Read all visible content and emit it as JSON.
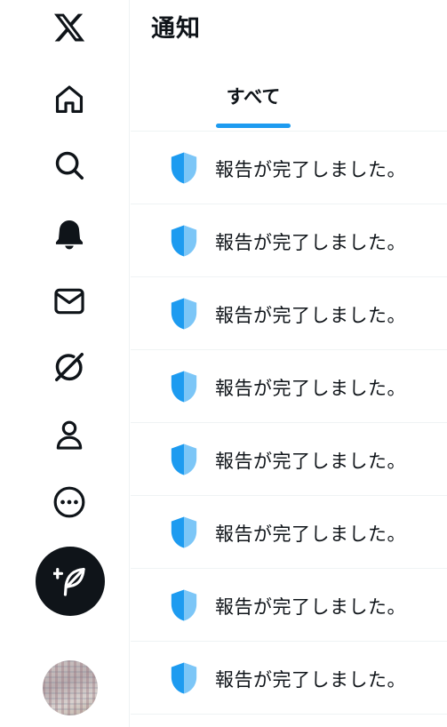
{
  "header": {
    "title": "通知"
  },
  "tabs": [
    {
      "label": "すべて",
      "active": true
    }
  ],
  "nav": {
    "items": [
      {
        "icon": "x-logo-icon"
      },
      {
        "icon": "home-icon"
      },
      {
        "icon": "search-icon"
      },
      {
        "icon": "notifications-bell-icon"
      },
      {
        "icon": "messages-mail-icon"
      },
      {
        "icon": "grok-icon"
      },
      {
        "icon": "profile-person-icon"
      },
      {
        "icon": "more-icon"
      }
    ],
    "compose": {
      "icon": "compose-post-icon"
    }
  },
  "notifications": [
    {
      "icon": "shield-icon",
      "text": "報告が完了しました。"
    },
    {
      "icon": "shield-icon",
      "text": "報告が完了しました。"
    },
    {
      "icon": "shield-icon",
      "text": "報告が完了しました。"
    },
    {
      "icon": "shield-icon",
      "text": "報告が完了しました。"
    },
    {
      "icon": "shield-icon",
      "text": "報告が完了しました。"
    },
    {
      "icon": "shield-icon",
      "text": "報告が完了しました。"
    },
    {
      "icon": "shield-icon",
      "text": "報告が完了しました。"
    },
    {
      "icon": "shield-icon",
      "text": "報告が完了しました。"
    }
  ],
  "colors": {
    "accent": "#1d9bf0",
    "text": "#0f1419",
    "divider": "#eff3f4",
    "shield": "#1d9bf0"
  }
}
